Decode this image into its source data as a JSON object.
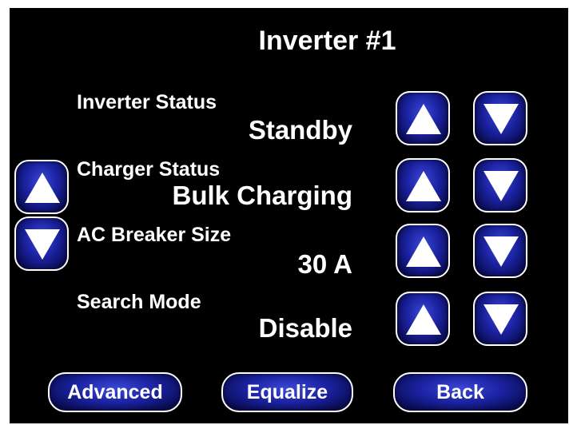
{
  "title": "Inverter #1",
  "settings": [
    {
      "label": "Inverter Status",
      "value": "Standby"
    },
    {
      "label": "Charger Status",
      "value": "Bulk Charging"
    },
    {
      "label": "AC Breaker Size",
      "value": "30 A"
    },
    {
      "label": "Search Mode",
      "value": "Disable"
    }
  ],
  "buttons": {
    "advanced": "Advanced",
    "equalize": "Equalize",
    "back": "Back"
  },
  "colors": {
    "background": "#000000",
    "button": "#1b22a0",
    "text": "#ffffff"
  }
}
